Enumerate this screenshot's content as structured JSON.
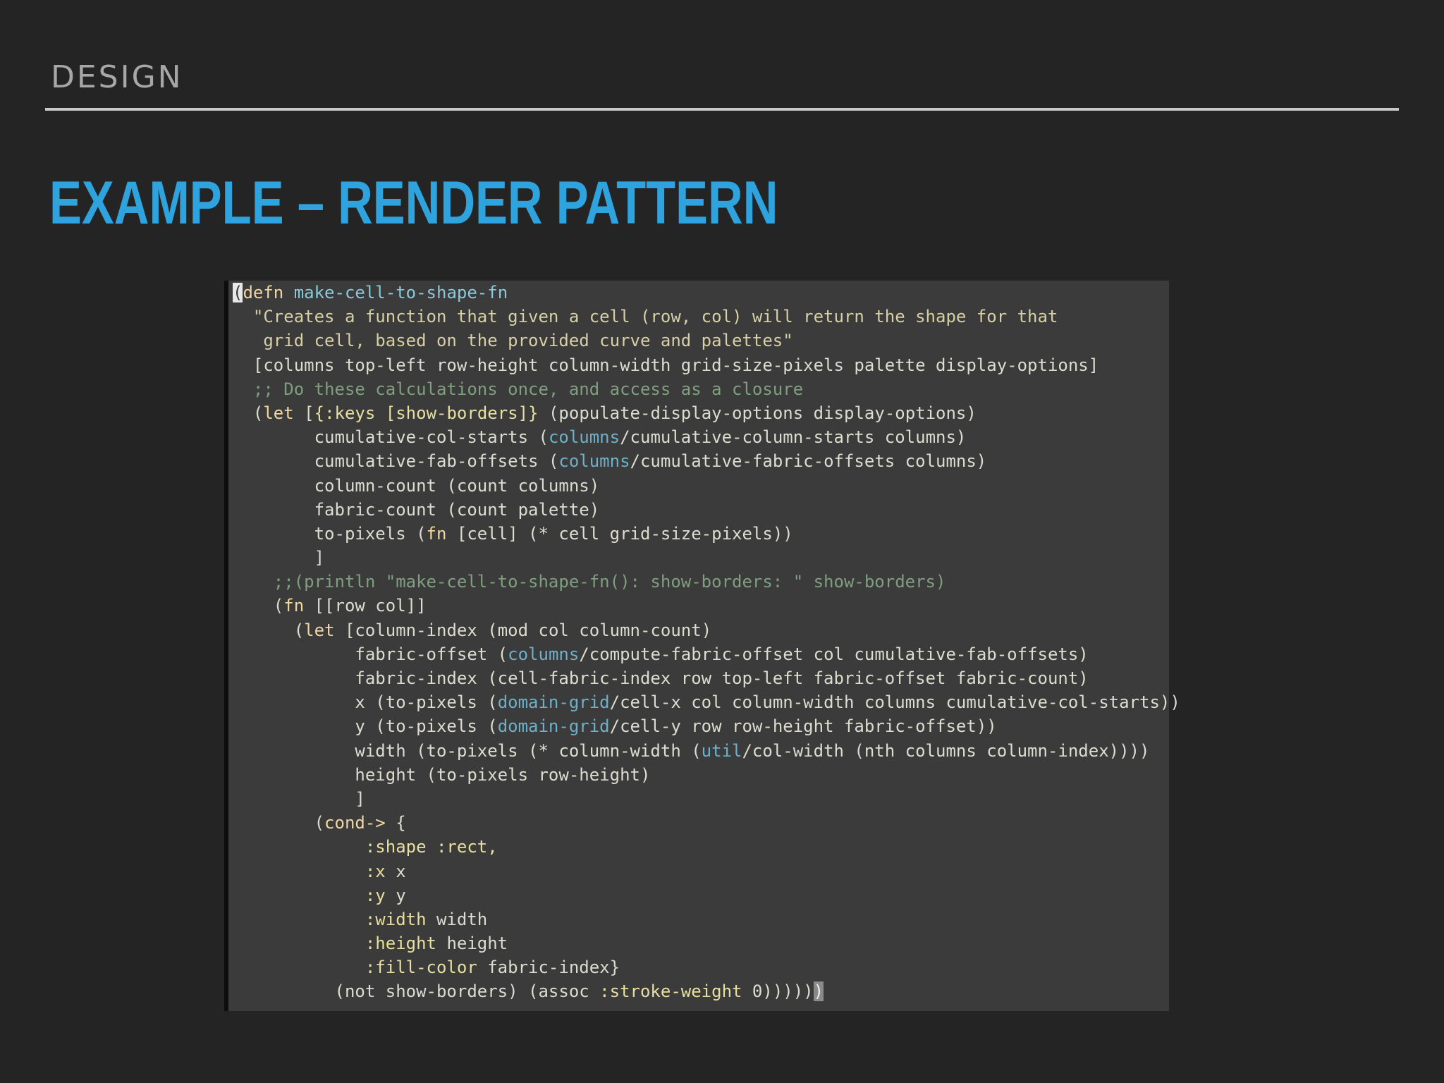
{
  "header": {
    "section": "DESIGN",
    "title": "EXAMPLE – RENDER PATTERN"
  },
  "code": {
    "language": "clojure",
    "lines": [
      [
        [
          "cursor",
          "("
        ],
        [
          "kw",
          "defn"
        ],
        [
          "text",
          " "
        ],
        [
          "fname",
          "make-cell-to-shape-fn"
        ]
      ],
      [
        [
          "str",
          "  \"Creates a function that given a cell (row, col) will return the shape for that"
        ]
      ],
      [
        [
          "str",
          "   grid cell, based on the provided curve and palettes\""
        ]
      ],
      [
        [
          "text",
          "  [columns top-left row-height column-width grid-size-pixels palette display-options]"
        ]
      ],
      [
        [
          "cmt",
          "  ;; Do these calculations once, and access as a closure"
        ]
      ],
      [
        [
          "text",
          "  ("
        ],
        [
          "kw",
          "let"
        ],
        [
          "text",
          " ["
        ],
        [
          "kwd",
          "{:keys [show-borders]}"
        ],
        [
          "text",
          " (populate-display-options display-options)"
        ]
      ],
      [
        [
          "text",
          "        cumulative-col-starts ("
        ],
        [
          "ns",
          "columns"
        ],
        [
          "text",
          "/cumulative-column-starts columns)"
        ]
      ],
      [
        [
          "text",
          "        cumulative-fab-offsets ("
        ],
        [
          "ns",
          "columns"
        ],
        [
          "text",
          "/cumulative-fabric-offsets columns)"
        ]
      ],
      [
        [
          "text",
          "        column-count (count columns)"
        ]
      ],
      [
        [
          "text",
          "        fabric-count (count palette)"
        ]
      ],
      [
        [
          "text",
          "        to-pixels ("
        ],
        [
          "kw",
          "fn"
        ],
        [
          "text",
          " [cell] (* cell grid-size-pixels))"
        ]
      ],
      [
        [
          "text",
          "        ]"
        ]
      ],
      [
        [
          "cmt",
          "    ;;(println \"make-cell-to-shape-fn(): show-borders: \" show-borders)"
        ]
      ],
      [
        [
          "text",
          "    ("
        ],
        [
          "kw",
          "fn"
        ],
        [
          "text",
          " [[row col]]"
        ]
      ],
      [
        [
          "text",
          "      ("
        ],
        [
          "kw",
          "let"
        ],
        [
          "text",
          " [column-index (mod col column-count)"
        ]
      ],
      [
        [
          "text",
          "            fabric-offset ("
        ],
        [
          "ns",
          "columns"
        ],
        [
          "text",
          "/compute-fabric-offset col cumulative-fab-offsets)"
        ]
      ],
      [
        [
          "text",
          "            fabric-index (cell-fabric-index row top-left fabric-offset fabric-count)"
        ]
      ],
      [
        [
          "text",
          "            x (to-pixels ("
        ],
        [
          "ns",
          "domain-grid"
        ],
        [
          "text",
          "/cell-x col column-width columns cumulative-col-starts))"
        ]
      ],
      [
        [
          "text",
          "            y (to-pixels ("
        ],
        [
          "ns",
          "domain-grid"
        ],
        [
          "text",
          "/cell-y row row-height fabric-offset))"
        ]
      ],
      [
        [
          "text",
          "            width (to-pixels (* column-width ("
        ],
        [
          "ns",
          "util"
        ],
        [
          "text",
          "/col-width (nth columns column-index))))"
        ]
      ],
      [
        [
          "text",
          "            height (to-pixels row-height)"
        ]
      ],
      [
        [
          "text",
          "            ]"
        ]
      ],
      [
        [
          "text",
          "        ("
        ],
        [
          "kw",
          "cond->"
        ],
        [
          "text",
          " {"
        ]
      ],
      [
        [
          "kwd",
          "             :shape :rect,"
        ]
      ],
      [
        [
          "kwd",
          "             :x "
        ],
        [
          "text",
          "x"
        ]
      ],
      [
        [
          "kwd",
          "             :y "
        ],
        [
          "text",
          "y"
        ]
      ],
      [
        [
          "kwd",
          "             :width "
        ],
        [
          "text",
          "width"
        ]
      ],
      [
        [
          "kwd",
          "             :height "
        ],
        [
          "text",
          "height"
        ]
      ],
      [
        [
          "kwd",
          "             :fill-color "
        ],
        [
          "text",
          "fabric-index}"
        ]
      ],
      [
        [
          "text",
          "          (not show-borders) (assoc "
        ],
        [
          "kwd",
          ":stroke-weight"
        ],
        [
          "text",
          " 0)))))"
        ],
        [
          "cursor-end",
          ")"
        ]
      ]
    ]
  }
}
